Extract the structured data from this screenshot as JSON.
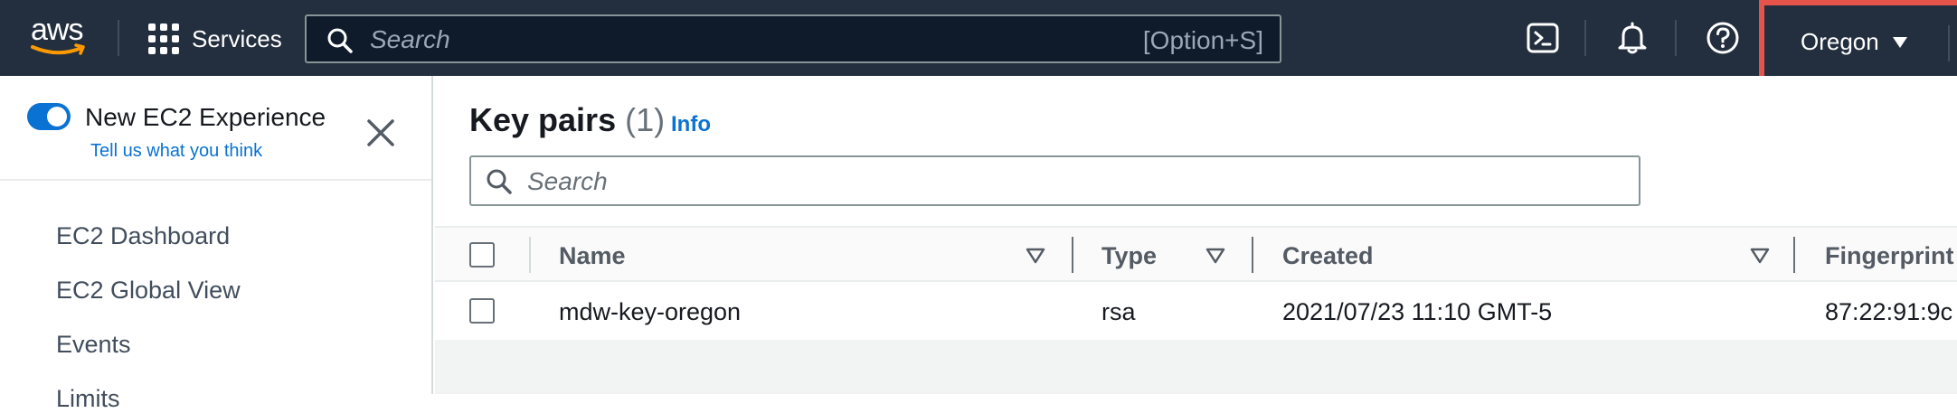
{
  "topnav": {
    "logo_text": "aws",
    "services_label": "Services",
    "search_placeholder": "Search",
    "search_shortcut": "[Option+S]",
    "region_label": "Oregon",
    "icons": [
      "cloudshell-icon",
      "bell-icon",
      "help-icon"
    ],
    "highlight_color": "#e5534b"
  },
  "sidebar": {
    "toggle_label": "New EC2 Experience",
    "toggle_on": true,
    "feedback_link": "Tell us what you think",
    "items": [
      {
        "label": "EC2 Dashboard"
      },
      {
        "label": "EC2 Global View"
      },
      {
        "label": "Events"
      },
      {
        "label": "Limits"
      }
    ]
  },
  "main": {
    "title": "Key pairs",
    "count": "(1)",
    "info_label": "Info",
    "filter_placeholder": "Search",
    "columns": [
      {
        "label": "Name"
      },
      {
        "label": "Type"
      },
      {
        "label": "Created"
      },
      {
        "label": "Fingerprint"
      }
    ],
    "rows": [
      {
        "name": "mdw-key-oregon",
        "type": "rsa",
        "created": "2021/07/23 11:10 GMT-5",
        "fingerprint": "87:22:91:9c"
      }
    ]
  },
  "colors": {
    "nav_bg": "#232f3e",
    "accent": "#0972d3"
  }
}
